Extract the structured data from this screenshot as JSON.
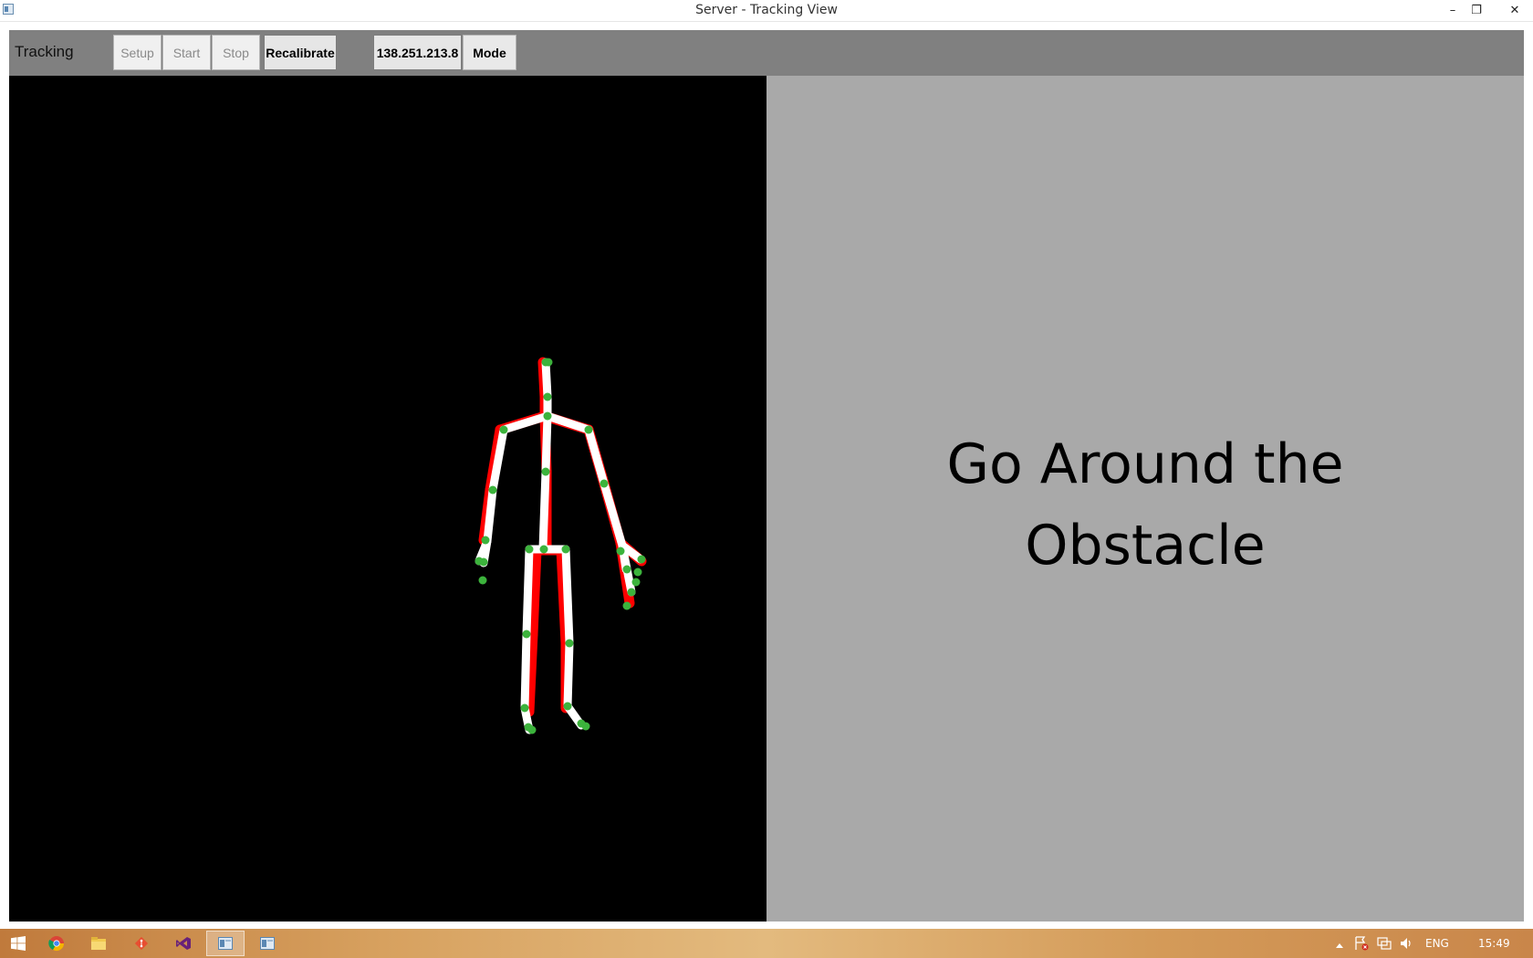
{
  "window": {
    "title": "Server - Tracking View",
    "controls": {
      "minimize": "–",
      "restore": "❐",
      "close": "✕"
    }
  },
  "toolbar": {
    "title": "Tracking",
    "buttons": [
      {
        "label": "Setup",
        "enabled": false
      },
      {
        "label": "Start",
        "enabled": false
      },
      {
        "label": "Stop",
        "enabled": false
      },
      {
        "label": "Recalibrate",
        "enabled": true
      },
      {
        "label": "138.251.213.8",
        "enabled": true
      },
      {
        "label": "Mode",
        "enabled": true
      }
    ]
  },
  "instruction": {
    "line1": "Go Around the",
    "line2": "Obstacle"
  },
  "colors": {
    "skeleton_bone": "#ffffff",
    "skeleton_shadow": "#ff0000",
    "joint": "#3cb33c",
    "tracking_bg": "#000000",
    "instruction_bg": "#a9a9a9",
    "toolbar_bg": "#808080"
  },
  "taskbar": {
    "apps": [
      "windows-start-icon",
      "chrome-icon",
      "file-explorer-icon",
      "git-icon",
      "visual-studio-icon",
      "app-window-icon",
      "app-window-icon"
    ],
    "tray": {
      "language": "ENG",
      "time": "15:49"
    }
  }
}
